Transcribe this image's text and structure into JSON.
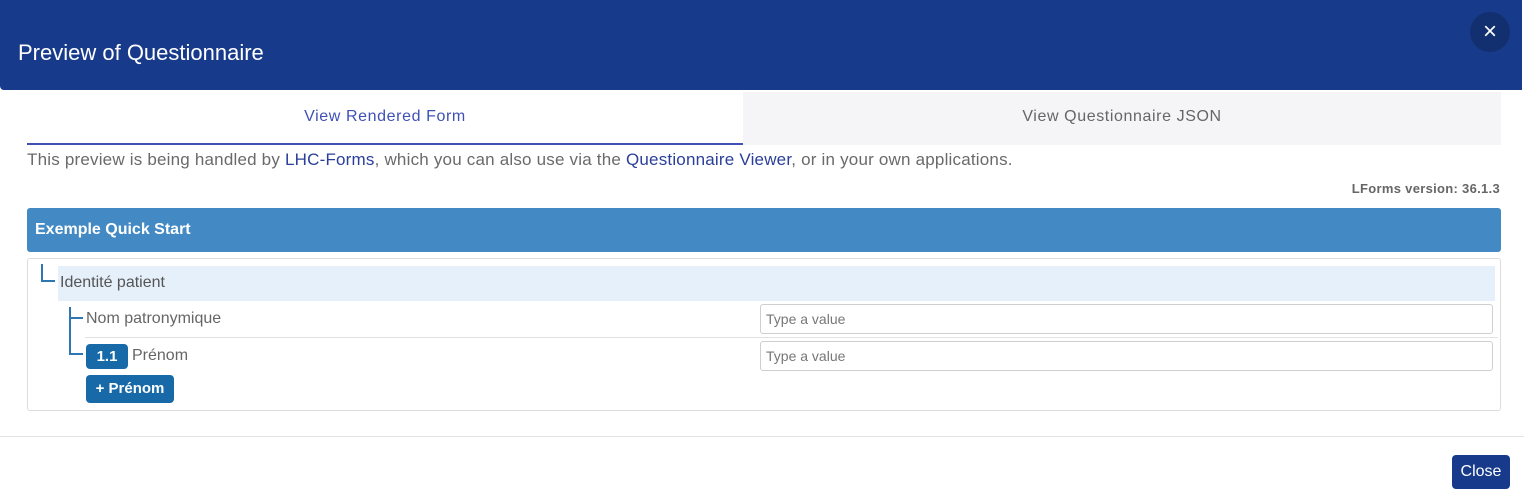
{
  "dialog": {
    "title": "Preview of Questionnaire",
    "close_icon": "×"
  },
  "tabs": [
    {
      "label": "View Rendered Form",
      "active": true
    },
    {
      "label": "View Questionnaire JSON",
      "active": false
    }
  ],
  "info": {
    "prefix": "This preview is being handled by ",
    "link1": "LHC-Forms",
    "middle": ", which you can also use via the ",
    "link2": "Questionnaire Viewer",
    "suffix": ", or in your own applications."
  },
  "version": "LForms version: 36.1.3",
  "form": {
    "title": "Exemple Quick Start",
    "group_label": "Identité patient",
    "items": [
      {
        "label": "Nom patronymique",
        "placeholder": "Type a value",
        "value": ""
      },
      {
        "badge": "1.1",
        "label": "Prénom",
        "placeholder": "Type a value",
        "value": ""
      }
    ],
    "add_button": "+ Prénom"
  },
  "footer": {
    "close_label": "Close"
  },
  "colors": {
    "header": "#173a8a",
    "accent": "#3f51b5",
    "form_title_bar": "#4389c4",
    "badge": "#1769a8"
  }
}
